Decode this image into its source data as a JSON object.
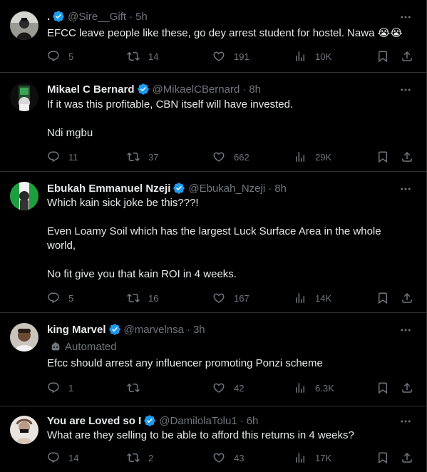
{
  "tweets": [
    {
      "name": ".",
      "handle": "@Sire__Gift",
      "time": "5h",
      "automated": "",
      "paragraphs": [
        "EFCC leave people like these, go dey arrest student for hostel. Nawa"
      ],
      "emoji": "😭😭",
      "replies": "5",
      "retweets": "14",
      "likes": "191",
      "views": "10K"
    },
    {
      "name": "Mikael C Bernard",
      "handle": "@MikaelCBernard",
      "time": "8h",
      "automated": "",
      "paragraphs": [
        "If it was this profitable, CBN itself will have invested.",
        "Ndi mgbu"
      ],
      "emoji": "",
      "replies": "11",
      "retweets": "37",
      "likes": "662",
      "views": "29K"
    },
    {
      "name": "Ebukah Emmanuel Nzeji",
      "handle": "@Ebukah_Nzeji",
      "time": "8h",
      "automated": "",
      "paragraphs": [
        "Which kain sick joke be this???!",
        "Even Loamy Soil which has the largest Luck Surface Area in the whole world,",
        "No fit give you that kain ROI in 4 weeks."
      ],
      "emoji": "",
      "replies": "5",
      "retweets": "16",
      "likes": "167",
      "views": "14K"
    },
    {
      "name": "king Marvel",
      "handle": "@marvelnsa",
      "time": "3h",
      "automated": "Automated",
      "paragraphs": [
        "Efcc should arrest any influencer promoting Ponzi scheme"
      ],
      "emoji": "",
      "replies": "1",
      "retweets": "",
      "likes": "42",
      "views": "6.3K"
    },
    {
      "name": "You are Loved so I",
      "handle": "@DamilolaTolu1",
      "time": "6h",
      "automated": "",
      "paragraphs": [
        "What are they selling to be able to afford this returns in 4 weeks?"
      ],
      "emoji": "",
      "replies": "14",
      "retweets": "2",
      "likes": "43",
      "views": "17K"
    }
  ],
  "icons": {
    "reply": "reply-icon",
    "retweet": "retweet-icon",
    "like": "heart-icon",
    "views": "views-icon",
    "bookmark": "bookmark-icon",
    "share": "share-icon",
    "more": "more-icon",
    "verified": "verified-badge-icon",
    "automated": "robot-icon"
  },
  "colors": {
    "background": "#000000",
    "text": "#e7e9ea",
    "secondary": "#71767b",
    "border": "#2f3336",
    "verified": "#1d9bf0"
  }
}
